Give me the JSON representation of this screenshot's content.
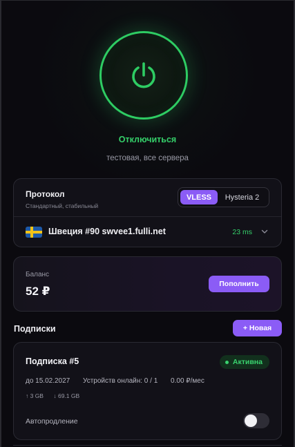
{
  "connection": {
    "action_label": "Отключиться",
    "subtitle": "тестовая, все сервера",
    "accent_color": "#2ecc63",
    "icon": "power-icon"
  },
  "protocol": {
    "title": "Протокол",
    "subtitle": "Стандартный, стабильный",
    "options": [
      "VLESS",
      "Hysteria 2"
    ],
    "selected": "VLESS"
  },
  "server": {
    "flag": "sweden-flag",
    "name": "Швеция #90 swvee1.fulli.net",
    "ping": "23 ms"
  },
  "balance": {
    "label": "Баланс",
    "value": "52 ₽",
    "topup_label": "Пополнить"
  },
  "subscriptions": {
    "heading": "Подписки",
    "new_label": "+ Новая",
    "items": [
      {
        "title": "Подписка #5",
        "status": "Активна",
        "expires": "до 15.02.2027",
        "devices": "Устройств онлайн: 0 / 1",
        "price": "0.00 ₽/мес",
        "upload": "↑ 3 GB",
        "download": "↓ 69.1 GB",
        "autorenew_label": "Автопродление",
        "autorenew": false
      }
    ]
  },
  "colors": {
    "accent_purple": "#8b5cf6",
    "success_green": "#35d06a"
  }
}
